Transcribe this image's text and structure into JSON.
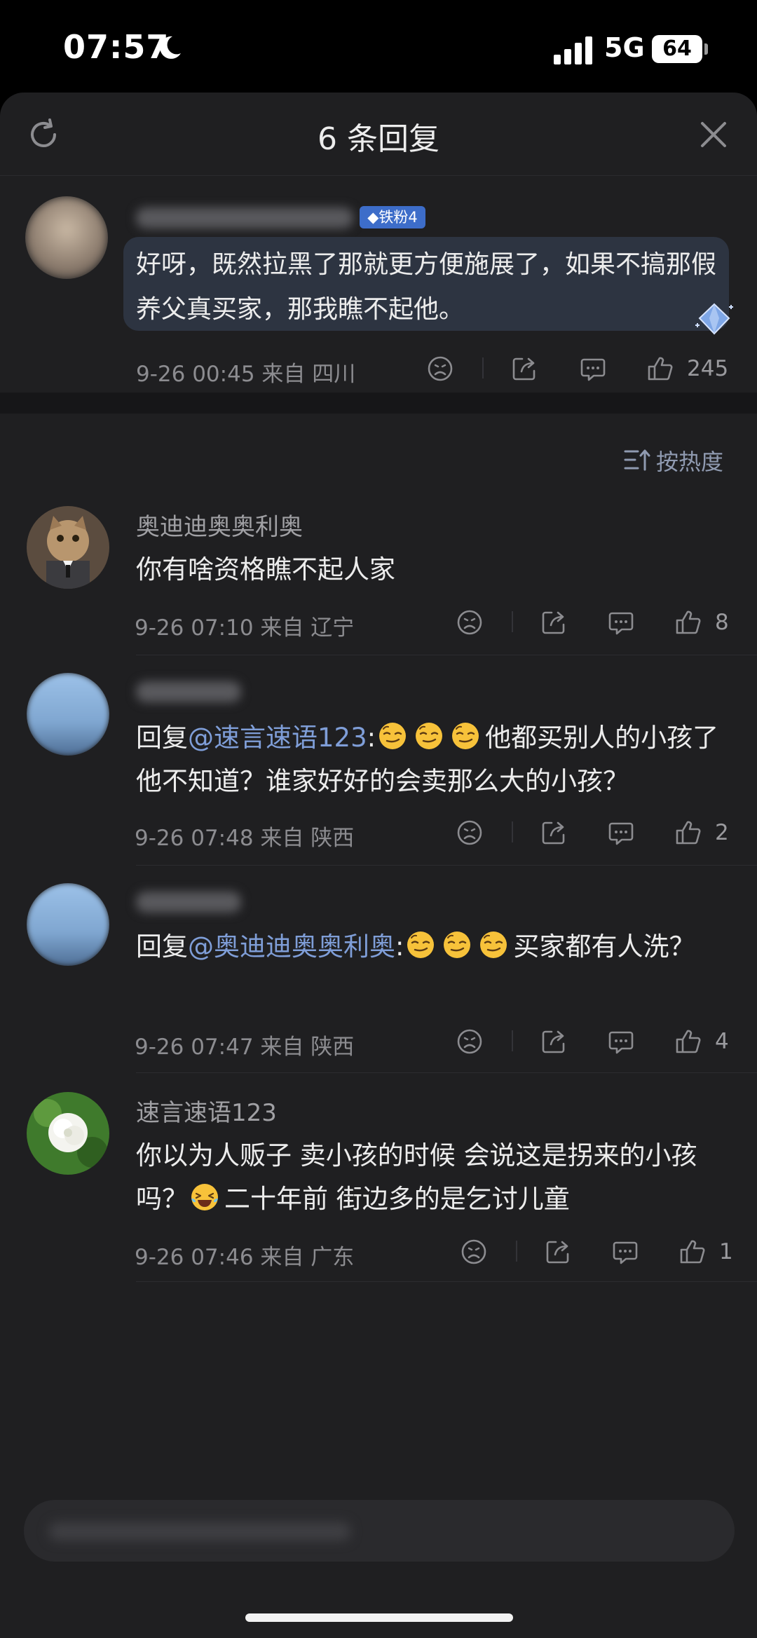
{
  "status_bar": {
    "time": "07:57",
    "network": "5G",
    "battery": "64"
  },
  "sheet": {
    "title": "6 条回复"
  },
  "original_comment": {
    "badge": "铁粉4",
    "text": "好呀，既然拉黑了那就更方便施展了，如果不搞那假养父真买家，那我瞧不起他。",
    "meta": "9-26 00:45 来自 四川",
    "like_count": "245"
  },
  "sort": {
    "label": "按热度"
  },
  "replies": [
    {
      "name": "奥迪迪奥奥利奥",
      "text": "你有啥资格瞧不起人家",
      "meta": "9-26 07:10 来自 辽宁",
      "like_count": "8"
    },
    {
      "prefix": "回复",
      "mention": "@速言速语123",
      "colon": ":",
      "text": "他都买别人的小孩了他不知道？谁家好好的会卖那么大的小孩？",
      "meta": "9-26 07:48 来自 陕西",
      "like_count": "2"
    },
    {
      "prefix": "回复",
      "mention": "@奥迪迪奥奥利奥",
      "colon": ":",
      "text": "买家都有人洗？",
      "meta": "9-26 07:47 来自 陕西",
      "like_count": "4"
    },
    {
      "name": "速言速语123",
      "text_a": "你以为人贩子 卖小孩的时候 会说这是拐来的小孩吗？",
      "text_b": "二十年前 街边多的是乞讨儿童",
      "meta": "9-26 07:46 来自 广东",
      "like_count": "1"
    }
  ],
  "icons": {
    "refresh": "refresh-icon",
    "close": "close-icon",
    "dislike": "frown-face-icon",
    "share": "share-icon",
    "comment": "comment-bubble-icon",
    "like": "thumbs-up-icon",
    "sort": "sort-icon",
    "emoji_smirk": "smirk-emoji-icon",
    "emoji_laugh": "laugh-tears-emoji-icon"
  },
  "colors": {
    "background": "#1f1f21",
    "accent_mention": "#7f9ed8",
    "badge": "#3d6dc9",
    "highlight_bubble": "#2d3441"
  }
}
